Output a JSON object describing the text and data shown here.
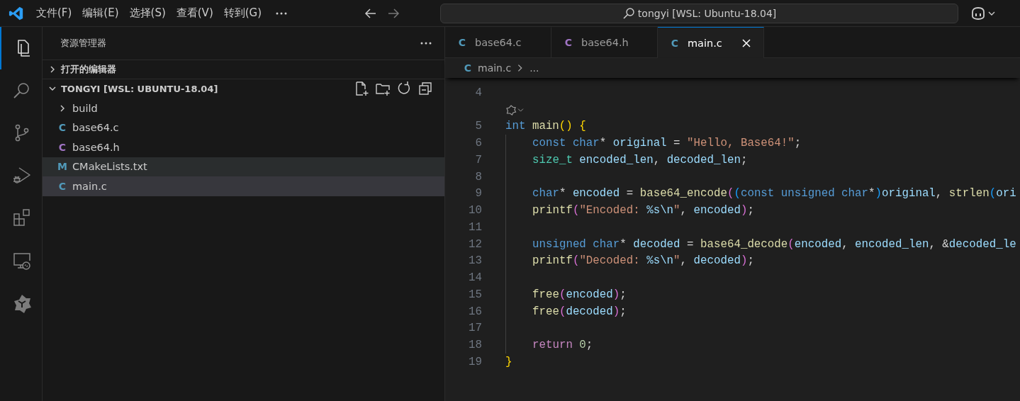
{
  "menu_bar": {
    "items": [
      "文件(F)",
      "编辑(E)",
      "选择(S)",
      "查看(V)",
      "转到(G)"
    ],
    "command_center": "tongyi [WSL: Ubuntu-18.04]"
  },
  "activity_bar": [
    {
      "kind": "explorer",
      "selected": true
    },
    {
      "kind": "search",
      "selected": false
    },
    {
      "kind": "source-control",
      "selected": false
    },
    {
      "kind": "run-debug",
      "selected": false
    },
    {
      "kind": "extensions",
      "selected": false
    },
    {
      "kind": "remote",
      "selected": false
    },
    {
      "kind": "tongyi",
      "selected": false
    }
  ],
  "sidebar": {
    "title": "资源管理器",
    "sections": [
      {
        "label": "打开的编辑器",
        "expanded": false
      },
      {
        "label": "TONGYI [WSL: UBUNTU-18.04]",
        "expanded": true
      }
    ],
    "items": [
      {
        "kind": "folder",
        "name": "build",
        "expanded": false,
        "selected": false,
        "hovered": false
      },
      {
        "kind": "c",
        "glyph": "C",
        "name": "base64.c",
        "selected": false,
        "hovered": false
      },
      {
        "kind": "h",
        "glyph": "C",
        "name": "base64.h",
        "selected": false,
        "hovered": false
      },
      {
        "kind": "cmake",
        "glyph": "M",
        "name": "CMakeLists.txt",
        "selected": false,
        "hovered": true
      },
      {
        "kind": "c",
        "glyph": "C",
        "name": "main.c",
        "selected": true,
        "hovered": false
      }
    ]
  },
  "tabs": [
    {
      "kind": "c",
      "glyph": "C",
      "label": "base64.c",
      "selected": false
    },
    {
      "kind": "h",
      "glyph": "C",
      "label": "base64.h",
      "selected": false
    },
    {
      "kind": "c",
      "glyph": "C",
      "label": "main.c",
      "selected": true
    }
  ],
  "breadcrumb": {
    "kind": "c",
    "glyph": "C",
    "file": "main.c",
    "rest": "..."
  },
  "code": {
    "lines": [
      {
        "number": "4"
      },
      {
        "kind": "codelens"
      },
      {
        "number": "5",
        "tokens": [
          {
            "text": "int ",
            "kind": "keyword"
          },
          {
            "text": "main",
            "kind": "function"
          },
          {
            "text": "()",
            "kind": "bracket1"
          },
          {
            "text": " {",
            "kind": "bracket1"
          }
        ],
        "children": [
          {
            "number": "6",
            "tokens": [
              {
                "text": "const char",
                "kind": "keyword"
              },
              {
                "text": "* ",
                "kind": "plain"
              },
              {
                "text": "original",
                "kind": "variable"
              },
              {
                "text": " = ",
                "kind": "plain"
              },
              {
                "text": "\"Hello, Base64!\"",
                "kind": "string"
              },
              {
                "text": ";",
                "kind": "plain"
              }
            ]
          },
          {
            "number": "7",
            "tokens": [
              {
                "text": "size_t",
                "kind": "type"
              },
              {
                "text": " encoded_len",
                "kind": "variable"
              },
              {
                "text": ", ",
                "kind": "plain"
              },
              {
                "text": "decoded_len",
                "kind": "variable"
              },
              {
                "text": ";",
                "kind": "plain"
              }
            ]
          },
          {
            "number": "8"
          },
          {
            "number": "9",
            "tokens": [
              {
                "text": "char",
                "kind": "keyword"
              },
              {
                "text": "* ",
                "kind": "plain"
              },
              {
                "text": "encoded",
                "kind": "variable"
              },
              {
                "text": " = ",
                "kind": "plain"
              },
              {
                "text": "base64_encode",
                "kind": "function"
              },
              {
                "text": "(",
                "kind": "bracket2"
              },
              {
                "text": "(",
                "kind": "bracket3"
              },
              {
                "text": "const unsigned char",
                "kind": "keyword"
              },
              {
                "text": "*",
                "kind": "plain"
              },
              {
                "text": ")",
                "kind": "bracket3"
              },
              {
                "text": "original",
                "kind": "variable"
              },
              {
                "text": ", ",
                "kind": "plain"
              },
              {
                "text": "strlen",
                "kind": "function"
              },
              {
                "text": "(",
                "kind": "bracket3"
              },
              {
                "text": "ori",
                "kind": "variable"
              }
            ]
          },
          {
            "number": "10",
            "tokens": [
              {
                "text": "printf",
                "kind": "function"
              },
              {
                "text": "(",
                "kind": "bracket2"
              },
              {
                "text": "\"Encoded: ",
                "kind": "string"
              },
              {
                "text": "%s\\n",
                "kind": "escape"
              },
              {
                "text": "\"",
                "kind": "string"
              },
              {
                "text": ", ",
                "kind": "plain"
              },
              {
                "text": "encoded",
                "kind": "variable"
              },
              {
                "text": ")",
                "kind": "bracket2"
              },
              {
                "text": ";",
                "kind": "plain"
              }
            ]
          },
          {
            "number": "11"
          },
          {
            "number": "12",
            "tokens": [
              {
                "text": "unsigned char",
                "kind": "keyword"
              },
              {
                "text": "* ",
                "kind": "plain"
              },
              {
                "text": "decoded",
                "kind": "variable"
              },
              {
                "text": " = ",
                "kind": "plain"
              },
              {
                "text": "base64_decode",
                "kind": "function"
              },
              {
                "text": "(",
                "kind": "bracket2"
              },
              {
                "text": "encoded",
                "kind": "variable"
              },
              {
                "text": ", ",
                "kind": "plain"
              },
              {
                "text": "encoded_len",
                "kind": "variable"
              },
              {
                "text": ", &",
                "kind": "plain"
              },
              {
                "text": "decoded_le",
                "kind": "variable"
              }
            ]
          },
          {
            "number": "13",
            "tokens": [
              {
                "text": "printf",
                "kind": "function"
              },
              {
                "text": "(",
                "kind": "bracket2"
              },
              {
                "text": "\"Decoded: ",
                "kind": "string"
              },
              {
                "text": "%s\\n",
                "kind": "escape"
              },
              {
                "text": "\"",
                "kind": "string"
              },
              {
                "text": ", ",
                "kind": "plain"
              },
              {
                "text": "decoded",
                "kind": "variable"
              },
              {
                "text": ")",
                "kind": "bracket2"
              },
              {
                "text": ";",
                "kind": "plain"
              }
            ]
          },
          {
            "number": "14"
          },
          {
            "number": "15",
            "tokens": [
              {
                "text": "free",
                "kind": "function"
              },
              {
                "text": "(",
                "kind": "bracket2"
              },
              {
                "text": "encoded",
                "kind": "variable"
              },
              {
                "text": ")",
                "kind": "bracket2"
              },
              {
                "text": ";",
                "kind": "plain"
              }
            ]
          },
          {
            "number": "16",
            "tokens": [
              {
                "text": "free",
                "kind": "function"
              },
              {
                "text": "(",
                "kind": "bracket2"
              },
              {
                "text": "decoded",
                "kind": "variable"
              },
              {
                "text": ")",
                "kind": "bracket2"
              },
              {
                "text": ";",
                "kind": "plain"
              }
            ]
          },
          {
            "number": "17"
          },
          {
            "number": "18",
            "tokens": [
              {
                "text": "return",
                "kind": "control"
              },
              {
                "text": " 0",
                "kind": "number"
              },
              {
                "text": ";",
                "kind": "plain"
              }
            ]
          }
        ]
      },
      {
        "number": "19",
        "tokens": [
          {
            "text": "}",
            "kind": "bracket1"
          }
        ]
      }
    ]
  }
}
